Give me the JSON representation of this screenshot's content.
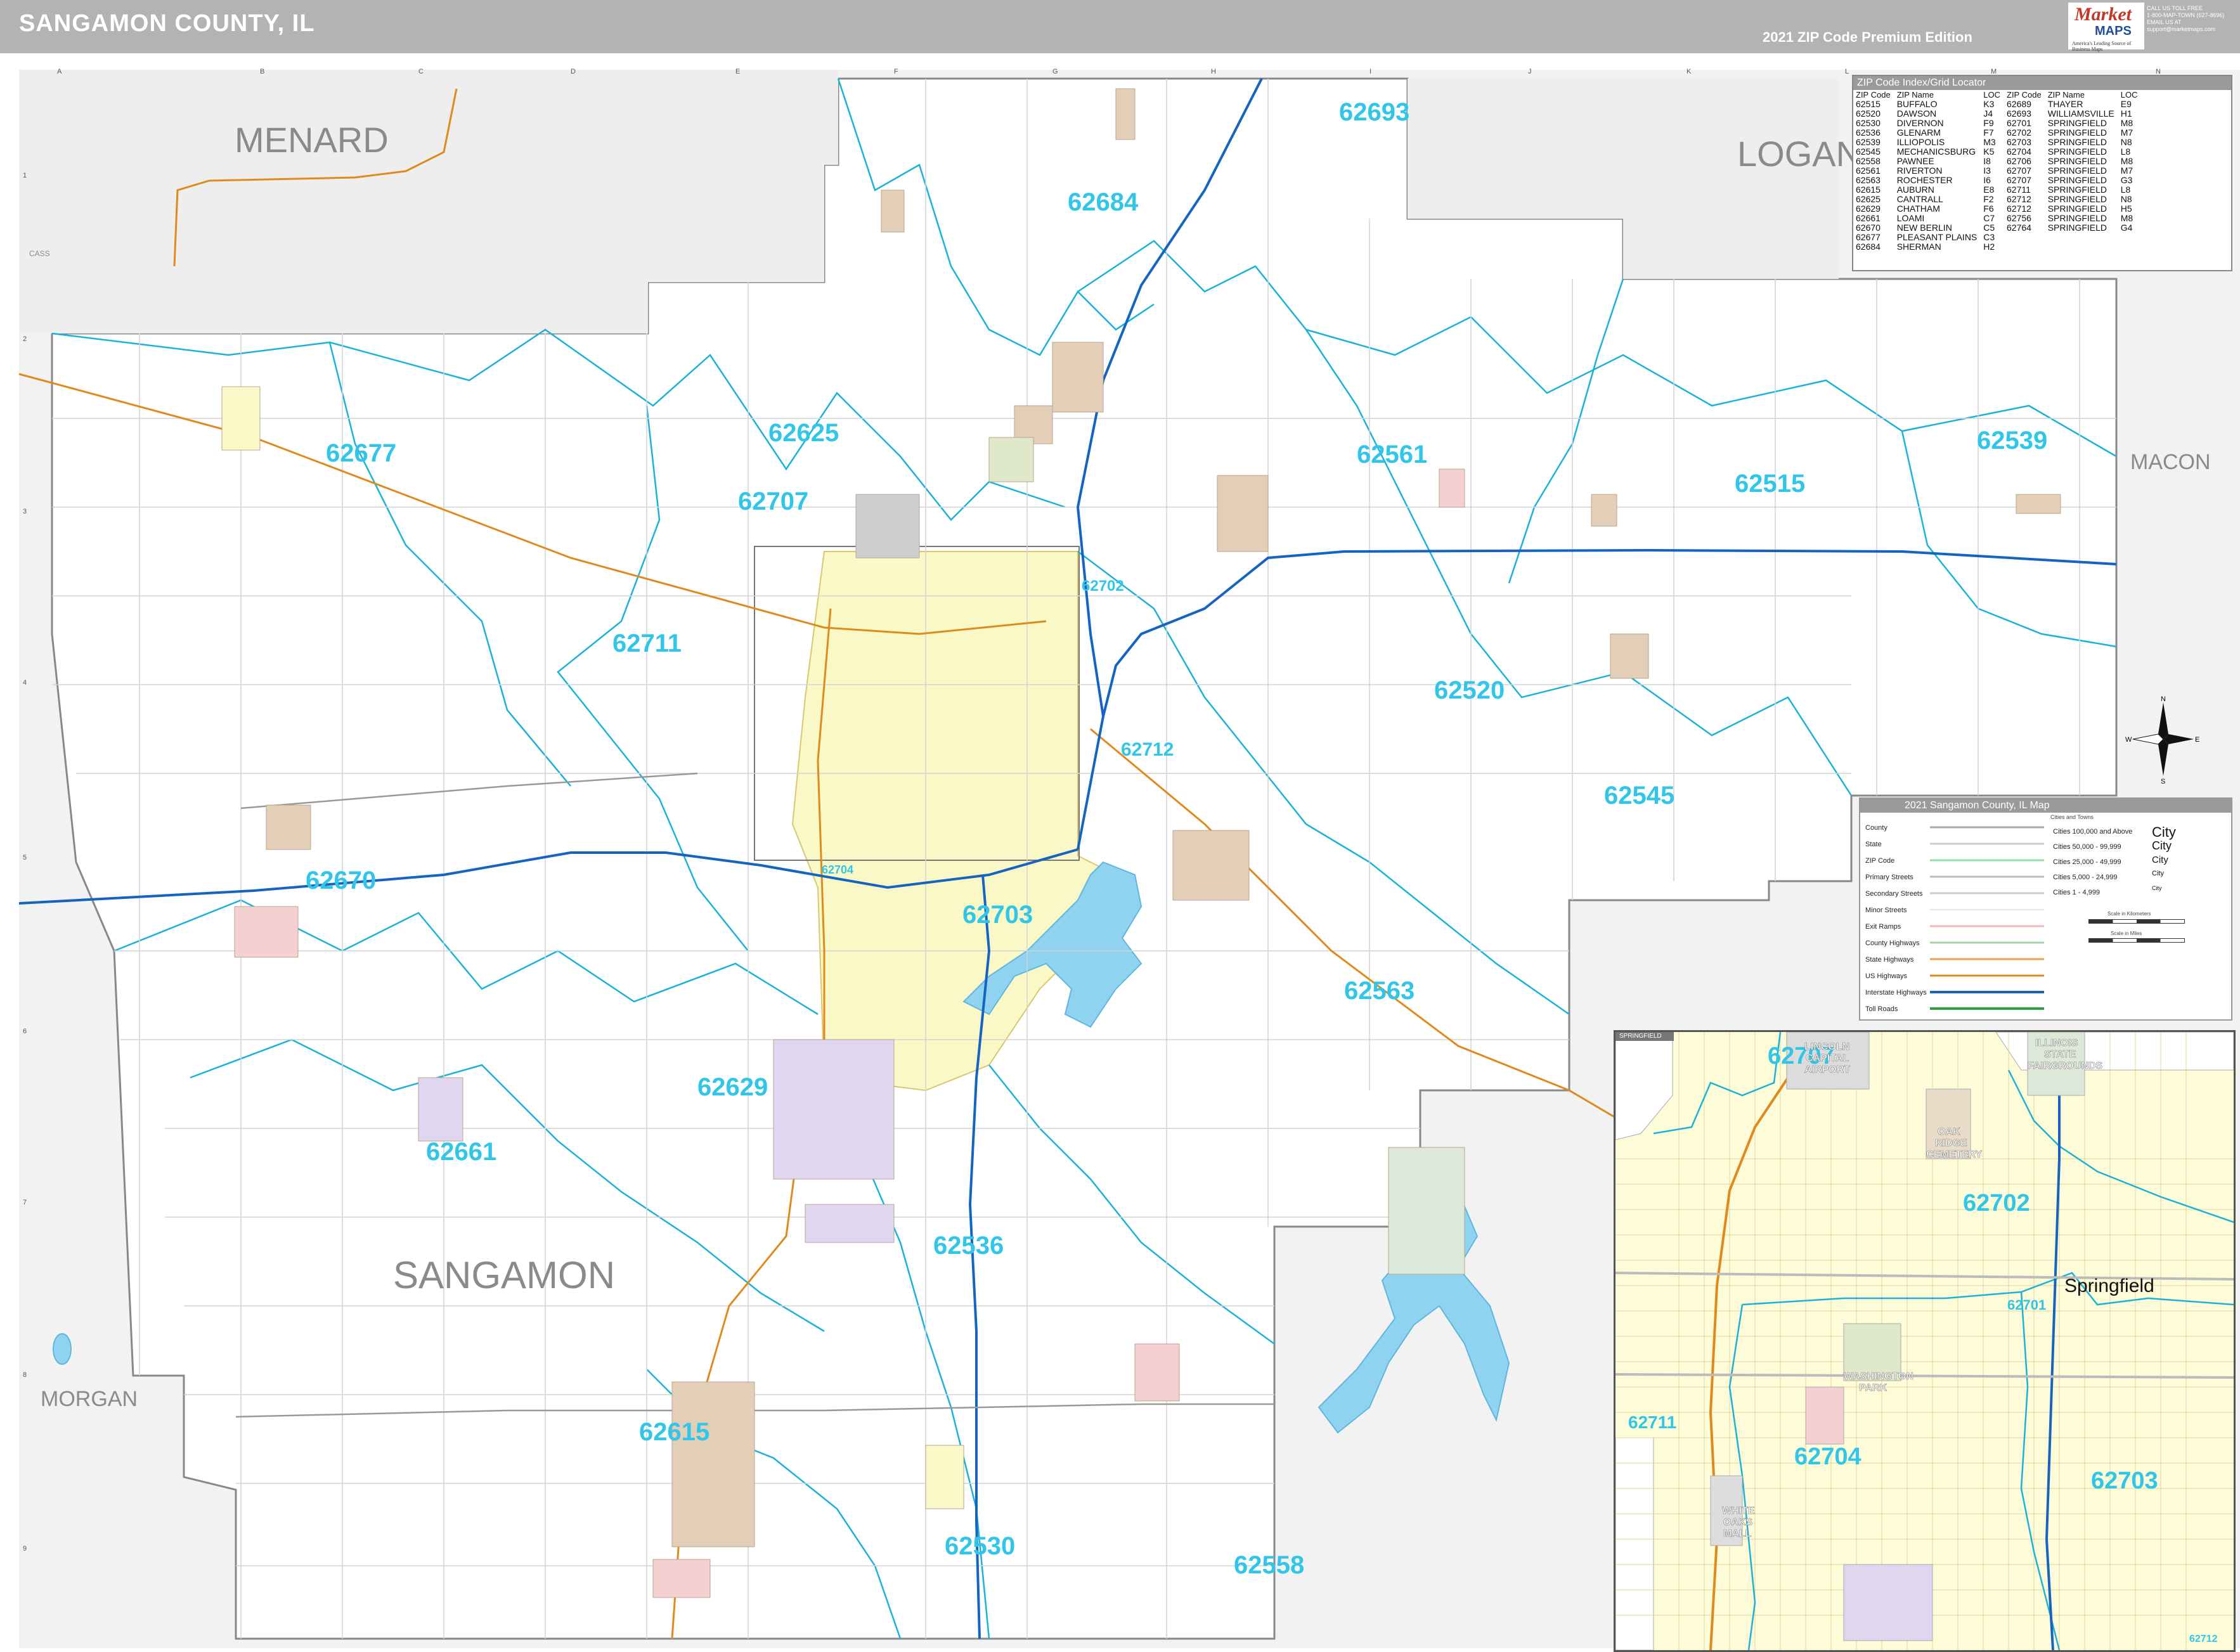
{
  "header": {
    "title": "SANGAMON COUNTY, IL",
    "edition": "2021 ZIP Code Premium Edition"
  },
  "logo": {
    "market": "Market",
    "maps": "MAPS",
    "tagline": "America's Leading Source of Business Maps",
    "contact": [
      "CALL US TOLL FREE",
      "1-800-MAP-TOWN (627-8696)",
      "EMAIL US AT",
      "support@marketmaps.com"
    ]
  },
  "grid": {
    "columns": [
      "A",
      "B",
      "C",
      "D",
      "E",
      "F",
      "G",
      "H",
      "I",
      "J",
      "K",
      "L",
      "M",
      "N"
    ],
    "rows": [
      "1",
      "2",
      "3",
      "4",
      "5",
      "6",
      "7",
      "8",
      "9"
    ]
  },
  "counties": {
    "menard": "MENARD",
    "logan": "LOGAN",
    "macon": "MACON",
    "morgan": "MORGAN",
    "sangamon": "SANGAMON",
    "cass": "CASS"
  },
  "zip_labels": {
    "z62693": "62693",
    "z62684": "62684",
    "z62625": "62625",
    "z62677": "62677",
    "z62707": "62707",
    "z62561": "62561",
    "z62515": "62515",
    "z62539": "62539",
    "z62711": "62711",
    "z62702": "62702",
    "z62520": "62520",
    "z62712": "62712",
    "z62545": "62545",
    "z62670": "62670",
    "z62704": "62704",
    "z62703": "62703",
    "z62563": "62563",
    "z62629": "62629",
    "z62661": "62661",
    "z62536": "62536",
    "z62615": "62615",
    "z62530": "62530",
    "z62558": "62558"
  },
  "zip_index": {
    "title": "ZIP Code Index/Grid Locator",
    "headers": [
      "ZIP Code",
      "ZIP Name",
      "LOC",
      "ZIP Code",
      "ZIP Name",
      "LOC"
    ],
    "rows": [
      [
        "62515",
        "BUFFALO",
        "K3",
        "62689",
        "THAYER",
        "E9"
      ],
      [
        "62520",
        "DAWSON",
        "J4",
        "62693",
        "WILLIAMSVILLE",
        "H1"
      ],
      [
        "62530",
        "DIVERNON",
        "F9",
        "62701",
        "SPRINGFIELD",
        "M8"
      ],
      [
        "62536",
        "GLENARM",
        "F7",
        "62702",
        "SPRINGFIELD",
        "M7"
      ],
      [
        "62539",
        "ILLIOPOLIS",
        "M3",
        "62703",
        "SPRINGFIELD",
        "N8"
      ],
      [
        "62545",
        "MECHANICSBURG",
        "K5",
        "62704",
        "SPRINGFIELD",
        "L8"
      ],
      [
        "62558",
        "PAWNEE",
        "I8",
        "62706",
        "SPRINGFIELD",
        "M8"
      ],
      [
        "62561",
        "RIVERTON",
        "I3",
        "62707",
        "SPRINGFIELD",
        "M7"
      ],
      [
        "62563",
        "ROCHESTER",
        "I6",
        "62707",
        "SPRINGFIELD",
        "G3"
      ],
      [
        "62615",
        "AUBURN",
        "E8",
        "62711",
        "SPRINGFIELD",
        "L8"
      ],
      [
        "62625",
        "CANTRALL",
        "F2",
        "62712",
        "SPRINGFIELD",
        "N8"
      ],
      [
        "62629",
        "CHATHAM",
        "F6",
        "62712",
        "SPRINGFIELD",
        "H5"
      ],
      [
        "62661",
        "LOAMI",
        "C7",
        "62756",
        "SPRINGFIELD",
        "M8"
      ],
      [
        "62670",
        "NEW BERLIN",
        "C5",
        "62764",
        "SPRINGFIELD",
        "G4"
      ],
      [
        "62677",
        "PLEASANT PLAINS",
        "C3",
        "",
        "",
        ""
      ],
      [
        "62684",
        "SHERMAN",
        "H2",
        "",
        "",
        ""
      ]
    ]
  },
  "legend": {
    "title": "2021 Sangamon County, IL Map",
    "subtitle": "Cities and Towns",
    "items": [
      "County",
      "State",
      "ZIP Code",
      "Primary Streets",
      "Secondary Streets",
      "Minor Streets",
      "Exit Ramps",
      "County Highways",
      "State Highways",
      "US Highways",
      "Interstate Highways",
      "Toll Roads"
    ],
    "cities": [
      {
        "label": "Cities 100,000 and Above",
        "sample": "City"
      },
      {
        "label": "Cities 50,000 - 99,999",
        "sample": "City"
      },
      {
        "label": "Cities 25,000 - 49,999",
        "sample": "City"
      },
      {
        "label": "Cities 5,000 - 24,999",
        "sample": "City"
      },
      {
        "label": "Cities 1 - 4,999",
        "sample": "City"
      }
    ],
    "scale_km": "Scale in Kilometers",
    "scale_mi": "Scale in Miles"
  },
  "inset": {
    "tab": "SPRINGFIELD",
    "city": "Springfield",
    "zips": {
      "i62707": "62707",
      "i62702": "62702",
      "i62701": "62701",
      "i62711": "62711",
      "i62704": "62704",
      "i62703": "62703",
      "i62712": "62712"
    },
    "places": {
      "airport": [
        "LINCOLN",
        "CAPITAL",
        "AIRPORT"
      ],
      "fair": [
        "ILLINOIS",
        "STATE",
        "FAIRGROUNDS"
      ],
      "cemetery": [
        "OAK",
        "RIDGE",
        "CEMETERY"
      ],
      "park": [
        "WASHINGTON",
        "PARK"
      ],
      "mall": [
        "WHITE",
        "OAKS",
        "MALL"
      ]
    }
  },
  "compass": {
    "n": "N",
    "s": "S",
    "e": "E",
    "w": "W"
  },
  "colors": {
    "zip_label": "#31c6e8",
    "zip_boundary": "#1ab2d8",
    "interstate": "#1565c0",
    "us_highway": "#e08a1e",
    "lake": "#8fd3f0",
    "city_fill": "#fbf8c8",
    "county_outside": "#f2f2f2"
  }
}
